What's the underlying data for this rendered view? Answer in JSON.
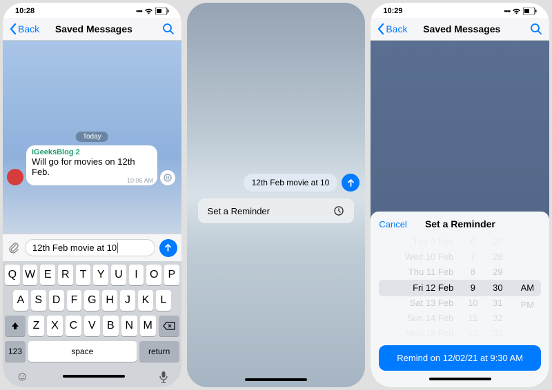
{
  "screen1": {
    "time": "10:28",
    "back": "Back",
    "title": "Saved Messages",
    "today": "Today",
    "msg_sender": "iGeeksBlog 2",
    "msg_text": "Will go for movies on 12th Feb.",
    "msg_time": "10:06 AM",
    "input_text": "12th Feb movie at 10",
    "keys_row1": [
      "Q",
      "W",
      "E",
      "R",
      "T",
      "Y",
      "U",
      "I",
      "O",
      "P"
    ],
    "keys_row2": [
      "A",
      "S",
      "D",
      "F",
      "G",
      "H",
      "J",
      "K",
      "L"
    ],
    "keys_row3": [
      "Z",
      "X",
      "C",
      "V",
      "B",
      "N",
      "M"
    ],
    "key_123": "123",
    "key_space": "space",
    "key_return": "return"
  },
  "screen2": {
    "bubble_text": "12th Feb movie at 10",
    "menu_label": "Set a Reminder"
  },
  "screen3": {
    "time": "10:29",
    "back": "Back",
    "title": "Saved Messages",
    "sheet_cancel": "Cancel",
    "sheet_title": "Set a Reminder",
    "dates": [
      "Tue 9 Feb",
      "Wed 10 Feb",
      "Thu 11 Feb",
      "Fri 12 Feb",
      "Sat 13 Feb",
      "Sun 14 Feb",
      "Mon 15 Feb"
    ],
    "hours": [
      "6",
      "7",
      "8",
      "9",
      "10",
      "11",
      "12"
    ],
    "mins": [
      "27",
      "28",
      "29",
      "30",
      "31",
      "32",
      "33"
    ],
    "ampm": [
      "AM",
      "PM"
    ],
    "remind_btn": "Remind on 12/02/21 at 9:30 AM"
  }
}
